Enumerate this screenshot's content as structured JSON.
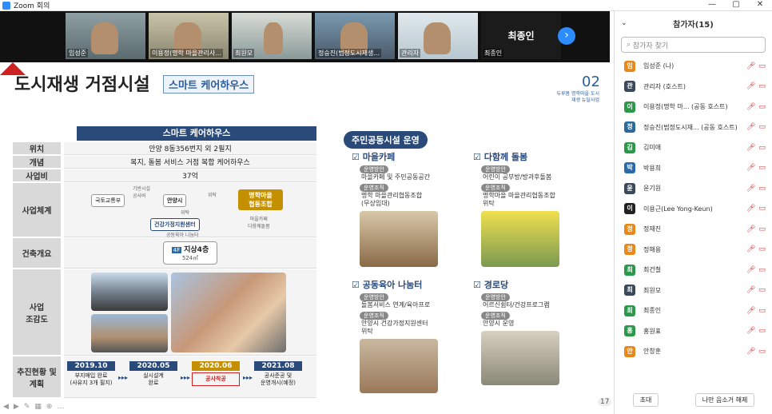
{
  "window": {
    "title": "Zoom 회의",
    "ctrl_min": "—",
    "ctrl_max": "▢",
    "ctrl_close": "✕"
  },
  "video_strip": {
    "tiles": [
      {
        "name": "임성준",
        "mic": "muted"
      },
      {
        "name": "이용정(명학 마을관리사...",
        "mic": "unmuted"
      },
      {
        "name": "최원모",
        "mic": "muted"
      },
      {
        "name": "정승진(범정도시재생...",
        "mic": "muted"
      },
      {
        "name": "관리자",
        "mic": "muted"
      },
      {
        "name": "최종인",
        "mic": "muted",
        "no_video_label": "최종인"
      }
    ],
    "next_icon": "chevron-right-icon"
  },
  "slide": {
    "title": "도시재생 거점시설",
    "subtitle": "스마트 케어하우스",
    "page_number": "02",
    "page_sub": "두루봄 명학마을 도시재생 뉴딜사업",
    "table_header": "스마트 케어하우스",
    "rows": [
      {
        "label": "위치",
        "value": "안양 8동356번지 외 2필지"
      },
      {
        "label": "개념",
        "value": "복지, 돌봄 서비스 거점 복합 케어하우스"
      },
      {
        "label": "사업비",
        "value": "37억"
      },
      {
        "label": "사업체계",
        "value": ""
      },
      {
        "label": "건축개요",
        "value": ""
      },
      {
        "label": "사업\n조감도",
        "value": ""
      },
      {
        "label": "추진현황 및\n계획",
        "value": ""
      }
    ],
    "org": {
      "ministry": "국토교통부",
      "city": "안양시",
      "coop": "명학마을\n협동조합",
      "center": "건강가정지원센터",
      "label_fund": "기반시설\n공사비",
      "label_entrust": "위탁",
      "label_entrust2": "위탁",
      "label_center_sub": "공동육아 나눔터",
      "label_coop_sub": "마을카페\n다함께돌봄"
    },
    "building": {
      "floors_tag": "4F",
      "floors": "지상4층",
      "area": "524㎡"
    },
    "timeline": [
      {
        "year": "2019.10",
        "desc": "부지매입 완료\n(사유지 3개 필지)",
        "highlight": false
      },
      {
        "year": "2020.05",
        "desc": "실시설계\n완료",
        "highlight": false
      },
      {
        "year": "2020.06",
        "desc": "공사착공",
        "highlight": true
      },
      {
        "year": "2021.08",
        "desc": "공사준공 및\n운영개시(예정)",
        "highlight": false
      }
    ],
    "right_header": "주민공동시설 운영",
    "sections": [
      {
        "title": "마을카페",
        "tag1": "운영방안",
        "v1": "마을카페 및 주민공동공간",
        "tag2": "운영조직",
        "v2": "명학 마을관리협동조합\n(무상임대)"
      },
      {
        "title": "다함께 돌봄",
        "tag1": "운영방안",
        "v1": "어린이 공부방/방과후돌봄",
        "tag2": "운영조직",
        "v2": "명학마을 마을관리협동조합\n위탁"
      },
      {
        "title": "공동육아 나눔터",
        "tag1": "운영방안",
        "v1": "돌봄서비스 연계/육아프로",
        "tag2": "운영조직",
        "v2": "안양시 건강가정지원센터\n위탁"
      },
      {
        "title": "경로당",
        "tag1": "운영방안",
        "v1": "어르신쉼터/건강프로그램",
        "tag2": "운영조직",
        "v2": "안양시 운영"
      }
    ],
    "slide_counter": "17"
  },
  "participants_panel": {
    "title": "참가자(15)",
    "search_placeholder": "참가자 찾기",
    "participants": [
      {
        "initial": "임",
        "name": "임성준 (나)",
        "color": "#e8891a"
      },
      {
        "initial": "관",
        "name": "관리자 (호스트)",
        "color": "#3a4a5a"
      },
      {
        "initial": "이",
        "name": "이용정(명학 마...  (공동 호스트)",
        "color": "#2a9a4a"
      },
      {
        "initial": "정",
        "name": "정승진(범정도시재...  (공동 호스트)",
        "color": "#2a6a9a"
      },
      {
        "initial": "김",
        "name": "김미애",
        "color": "#2a9a4a"
      },
      {
        "initial": "박",
        "name": "박용희",
        "color": "#2a6aaa"
      },
      {
        "initial": "윤",
        "name": "윤기원",
        "color": "#3a4a5a"
      },
      {
        "initial": "이",
        "name": "이용근(Lee Yong-Keun)",
        "color": "#222"
      },
      {
        "initial": "정",
        "name": "정재진",
        "color": "#e8891a"
      },
      {
        "initial": "정",
        "name": "정해용",
        "color": "#e8891a"
      },
      {
        "initial": "최",
        "name": "최건철",
        "color": "#2a9a4a"
      },
      {
        "initial": "최",
        "name": "최원모",
        "color": "#3a4a5a"
      },
      {
        "initial": "최",
        "name": "최종인",
        "color": "#2a9a4a"
      },
      {
        "initial": "홍",
        "name": "홍원표",
        "color": "#2a9a4a"
      },
      {
        "initial": "안",
        "name": "안창훈",
        "color": "#e8891a"
      }
    ],
    "invite_label": "초대",
    "mute_me_label": "나만 음소거 해제"
  }
}
